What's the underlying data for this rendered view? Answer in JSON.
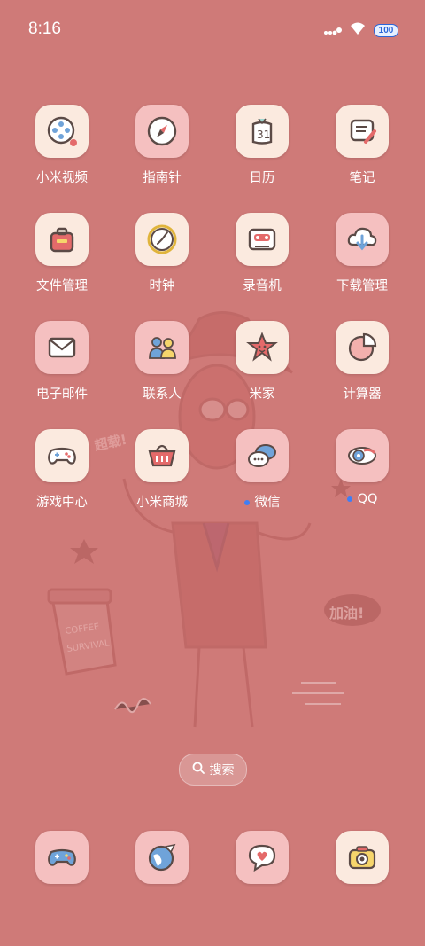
{
  "status": {
    "time": "8:16",
    "battery": "100"
  },
  "apps": [
    {
      "label": "小米视频",
      "icon": "video-reel-icon",
      "notify": false
    },
    {
      "label": "指南针",
      "icon": "compass-icon",
      "notify": false
    },
    {
      "label": "日历",
      "icon": "calendar-icon",
      "calendar_day": "31",
      "notify": false
    },
    {
      "label": "笔记",
      "icon": "notes-icon",
      "notify": false
    },
    {
      "label": "文件管理",
      "icon": "briefcase-icon",
      "notify": false
    },
    {
      "label": "时钟",
      "icon": "clock-icon",
      "notify": false
    },
    {
      "label": "录音机",
      "icon": "cassette-icon",
      "notify": false
    },
    {
      "label": "下载管理",
      "icon": "cloud-download-icon",
      "notify": false
    },
    {
      "label": "电子邮件",
      "icon": "envelope-icon",
      "notify": false
    },
    {
      "label": "联系人",
      "icon": "contacts-icon",
      "notify": false
    },
    {
      "label": "米家",
      "icon": "star-face-icon",
      "notify": false
    },
    {
      "label": "计算器",
      "icon": "pie-chart-icon",
      "notify": false
    },
    {
      "label": "游戏中心",
      "icon": "gamepad-icon",
      "notify": false
    },
    {
      "label": "小米商城",
      "icon": "basket-icon",
      "notify": false
    },
    {
      "label": "微信",
      "icon": "chat-bubbles-icon",
      "notify": true
    },
    {
      "label": "QQ",
      "icon": "penguin-icon",
      "notify": true
    }
  ],
  "search": {
    "label": "搜索"
  },
  "dock": [
    {
      "icon": "game-controller-icon"
    },
    {
      "icon": "globe-plane-icon"
    },
    {
      "icon": "heart-chat-icon"
    },
    {
      "icon": "camera-icon"
    }
  ],
  "wallpaper": {
    "texts": [
      "加油!",
      "超载!",
      "COFFEE",
      "SURVIVAL"
    ]
  },
  "colors": {
    "background": "#cf7a78",
    "tile": "#fbeadf",
    "tile_pink": "#f5c0c0",
    "notify_dot": "#3f7ef5"
  }
}
